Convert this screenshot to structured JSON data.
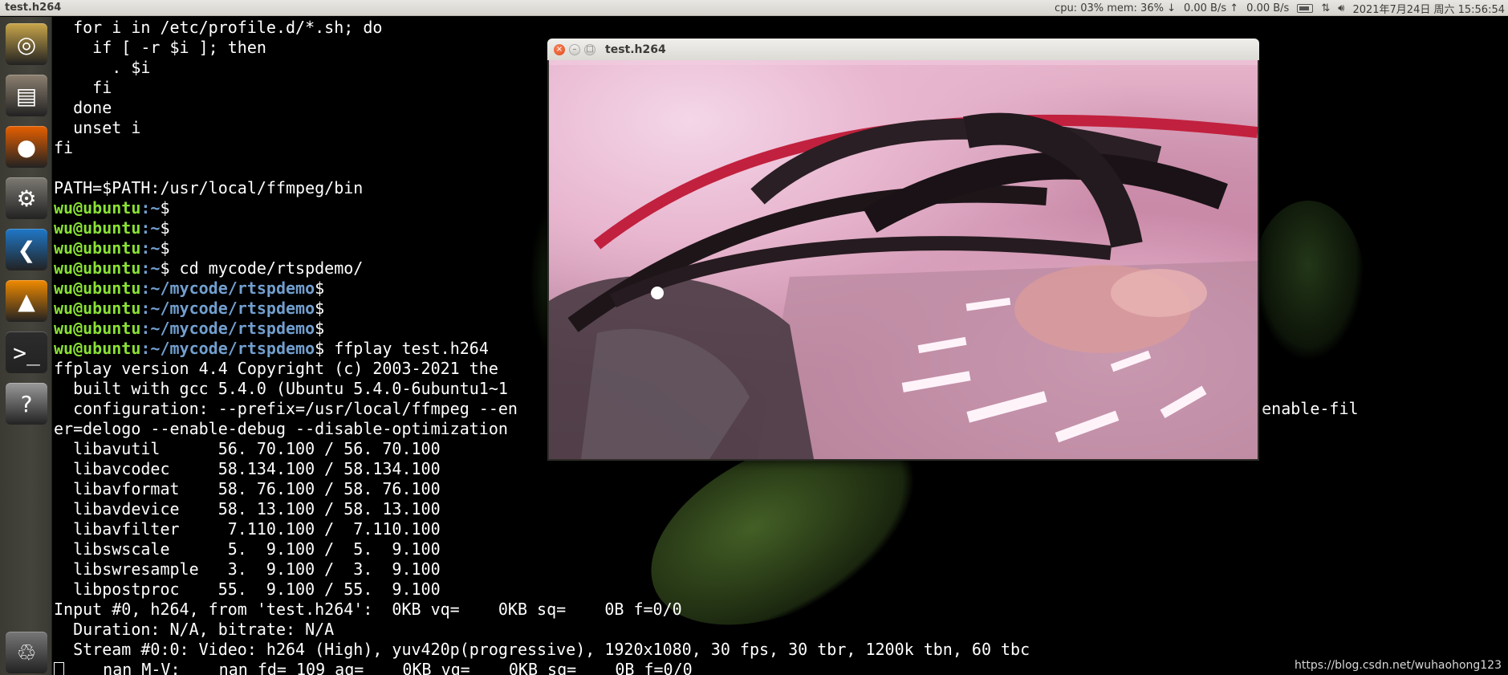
{
  "panel": {
    "app_title": "test.h264",
    "sysmon": "cpu: 03% mem: 36% ↓",
    "net_down": "0.00 B/s ↑",
    "net_up": "0.00 B/s",
    "clock": "2021年7月24日 周六 15:56:54"
  },
  "launcher": {
    "items": [
      {
        "name": "ubuntu-dash",
        "glyph": "◎",
        "color": "#c9a64a"
      },
      {
        "name": "files",
        "glyph": "▤",
        "color": "#8c8070"
      },
      {
        "name": "firefox",
        "glyph": "●",
        "color": "#e66000"
      },
      {
        "name": "system-settings",
        "glyph": "⚙",
        "color": "#7d7a73"
      },
      {
        "name": "vscode",
        "glyph": "❮",
        "color": "#1f78c8"
      },
      {
        "name": "vlc",
        "glyph": "▲",
        "color": "#f08a00"
      },
      {
        "name": "terminal",
        "glyph": ">_",
        "color": "#2c2c2c"
      },
      {
        "name": "help",
        "glyph": "?",
        "color": "#9a9a9a"
      },
      {
        "name": "trash",
        "glyph": "♲",
        "color": "#777"
      }
    ]
  },
  "terminal": {
    "lines": [
      {
        "text": "  for i in /etc/profile.d/*.sh; do"
      },
      {
        "text": "    if [ -r $i ]; then"
      },
      {
        "text": "      . $i"
      },
      {
        "text": "    fi"
      },
      {
        "text": "  done"
      },
      {
        "text": "  unset i"
      },
      {
        "text": "fi"
      },
      {
        "text": ""
      },
      {
        "text": "PATH=$PATH:/usr/local/ffmpeg/bin"
      },
      {
        "user": "wu@ubuntu",
        "path": ":~",
        "text": "$"
      },
      {
        "user": "wu@ubuntu",
        "path": ":~",
        "text": "$"
      },
      {
        "user": "wu@ubuntu",
        "path": ":~",
        "text": "$"
      },
      {
        "user": "wu@ubuntu",
        "path": ":~",
        "text": "$ cd mycode/rtspdemo/"
      },
      {
        "user": "wu@ubuntu",
        "path": ":~/mycode/rtspdemo",
        "text": "$"
      },
      {
        "user": "wu@ubuntu",
        "path": ":~/mycode/rtspdemo",
        "text": "$"
      },
      {
        "user": "wu@ubuntu",
        "path": ":~/mycode/rtspdemo",
        "text": "$"
      },
      {
        "user": "wu@ubuntu",
        "path": ":~/mycode/rtspdemo",
        "text": "$ ffplay test.h264"
      },
      {
        "text": "ffplay version 4.4 Copyright (c) 2003-2021 the "
      },
      {
        "text": "  built with gcc 5.4.0 (Ubuntu 5.4.0-6ubuntu1~1"
      },
      {
        "text": "  configuration: --prefix=/usr/local/ffmpeg --en                                                              able-libx265 --enable-fil"
      },
      {
        "text": "er=delogo --enable-debug --disable-optimization"
      },
      {
        "text": "  libavutil      56. 70.100 / 56. 70.100"
      },
      {
        "text": "  libavcodec     58.134.100 / 58.134.100"
      },
      {
        "text": "  libavformat    58. 76.100 / 58. 76.100"
      },
      {
        "text": "  libavdevice    58. 13.100 / 58. 13.100"
      },
      {
        "text": "  libavfilter     7.110.100 /  7.110.100"
      },
      {
        "text": "  libswscale      5.  9.100 /  5.  9.100"
      },
      {
        "text": "  libswresample   3.  9.100 /  3.  9.100"
      },
      {
        "text": "  libpostproc    55.  9.100 / 55.  9.100"
      },
      {
        "text": "Input #0, h264, from 'test.h264':  0KB vq=    0KB sq=    0B f=0/0"
      },
      {
        "text": "  Duration: N/A, bitrate: N/A"
      },
      {
        "text": "  Stream #0:0: Video: h264 (High), yuv420p(progressive), 1920x1080, 30 fps, 30 tbr, 1200k tbn, 60 tbc"
      },
      {
        "text": "    nan M-V:    nan fd= 109 aq=    0KB vq=    0KB sq=    0B f=0/0",
        "cursor": true
      }
    ]
  },
  "video_window": {
    "title": "test.h264",
    "close_glyph": "×",
    "min_glyph": "–",
    "max_glyph": "□"
  },
  "watermark": "https://blog.csdn.net/wuhaohong123"
}
